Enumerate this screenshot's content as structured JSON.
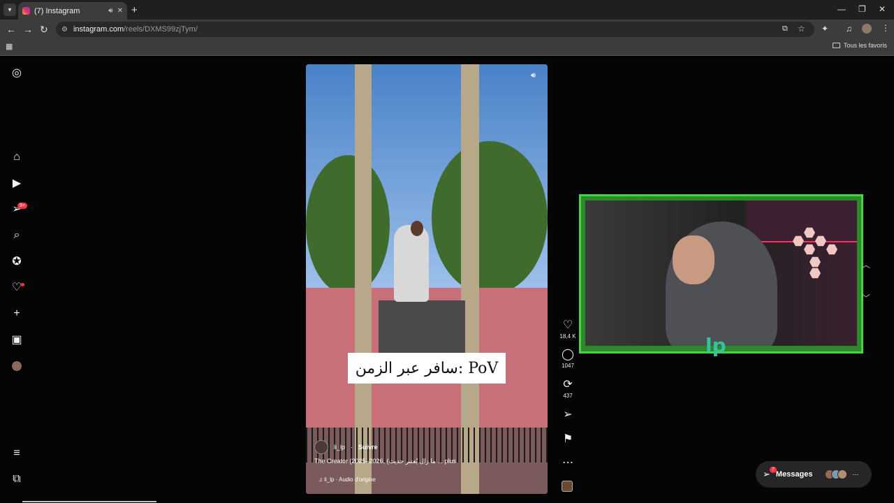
{
  "browser": {
    "tab_title": "(7) Instagram",
    "url_host": "instagram.com",
    "url_path": "/reels/DXMS99zjTym/",
    "bookmarks_label": "Tous les favoris"
  },
  "sidebar": {
    "notifications_badge": "9+"
  },
  "reel": {
    "overlay_text": "سافر عبر الزمن: PoV",
    "author": "li_lp",
    "follow_label": "Suivre",
    "description": "The Creator (2025–2026, (ما زال يُعتبر حديث ... plus",
    "audio": "li_lp · Audio d'origine"
  },
  "actions": {
    "likes": "18,4 K",
    "comments": "1047",
    "reposts": "437"
  },
  "messages": {
    "label": "Messages",
    "badge": "7"
  },
  "overlay_logo": "lp"
}
